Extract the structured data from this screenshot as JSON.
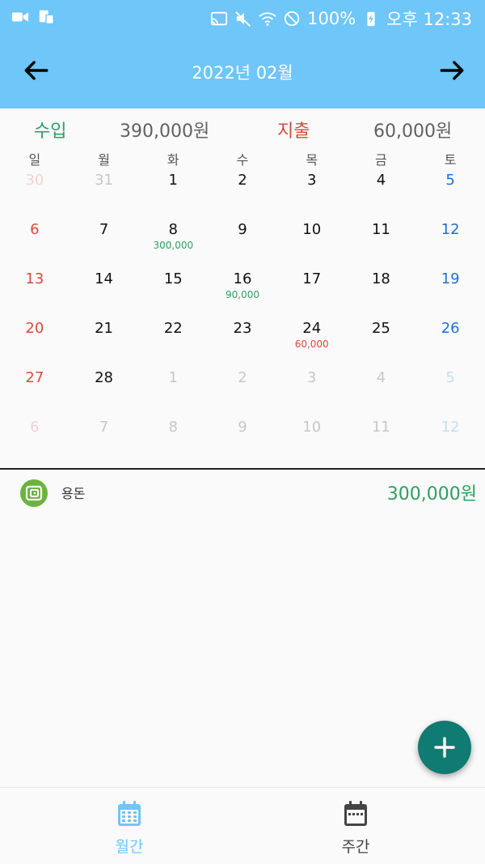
{
  "status_bar": {
    "battery": "100%",
    "time": "오후 12:33"
  },
  "header": {
    "title": "2022년 02월",
    "prev_icon": "arrow-left-icon",
    "next_icon": "arrow-right-icon"
  },
  "summary": {
    "income_label": "수입",
    "income_value": "390,000원",
    "expense_label": "지출",
    "expense_value": "60,000원"
  },
  "calendar": {
    "weekdays": [
      "일",
      "월",
      "화",
      "수",
      "목",
      "금",
      "토"
    ],
    "days": [
      {
        "day": "30",
        "current": false
      },
      {
        "day": "31",
        "current": false
      },
      {
        "day": "1",
        "current": true
      },
      {
        "day": "2",
        "current": true
      },
      {
        "day": "3",
        "current": true
      },
      {
        "day": "4",
        "current": true
      },
      {
        "day": "5",
        "current": true
      },
      {
        "day": "6",
        "current": true
      },
      {
        "day": "7",
        "current": true
      },
      {
        "day": "8",
        "current": true,
        "amount": "300,000",
        "type": "income"
      },
      {
        "day": "9",
        "current": true
      },
      {
        "day": "10",
        "current": true
      },
      {
        "day": "11",
        "current": true
      },
      {
        "day": "12",
        "current": true
      },
      {
        "day": "13",
        "current": true
      },
      {
        "day": "14",
        "current": true
      },
      {
        "day": "15",
        "current": true
      },
      {
        "day": "16",
        "current": true,
        "amount": "90,000",
        "type": "income"
      },
      {
        "day": "17",
        "current": true
      },
      {
        "day": "18",
        "current": true
      },
      {
        "day": "19",
        "current": true
      },
      {
        "day": "20",
        "current": true
      },
      {
        "day": "21",
        "current": true
      },
      {
        "day": "22",
        "current": true
      },
      {
        "day": "23",
        "current": true
      },
      {
        "day": "24",
        "current": true,
        "amount": "60,000",
        "type": "expense"
      },
      {
        "day": "25",
        "current": true
      },
      {
        "day": "26",
        "current": true
      },
      {
        "day": "27",
        "current": true
      },
      {
        "day": "28",
        "current": true
      },
      {
        "day": "1",
        "current": false
      },
      {
        "day": "2",
        "current": false
      },
      {
        "day": "3",
        "current": false
      },
      {
        "day": "4",
        "current": false
      },
      {
        "day": "5",
        "current": false
      },
      {
        "day": "6",
        "current": false
      },
      {
        "day": "7",
        "current": false
      },
      {
        "day": "8",
        "current": false
      },
      {
        "day": "9",
        "current": false
      },
      {
        "day": "10",
        "current": false
      },
      {
        "day": "11",
        "current": false
      },
      {
        "day": "12",
        "current": false
      }
    ]
  },
  "transactions": [
    {
      "category": "용돈",
      "amount": "300,000원",
      "icon": "wallet-icon"
    }
  ],
  "fab": {
    "icon": "plus-icon"
  },
  "bottom_nav": [
    {
      "label": "월간",
      "icon": "calendar-month-icon",
      "active": true
    },
    {
      "label": "주간",
      "icon": "calendar-week-icon",
      "active": false
    }
  ],
  "colors": {
    "primary": "#6ec6f9",
    "income": "#2e9e62",
    "expense": "#d64a3b",
    "saturday": "#1e6fd1",
    "fab": "#0f7b72"
  }
}
